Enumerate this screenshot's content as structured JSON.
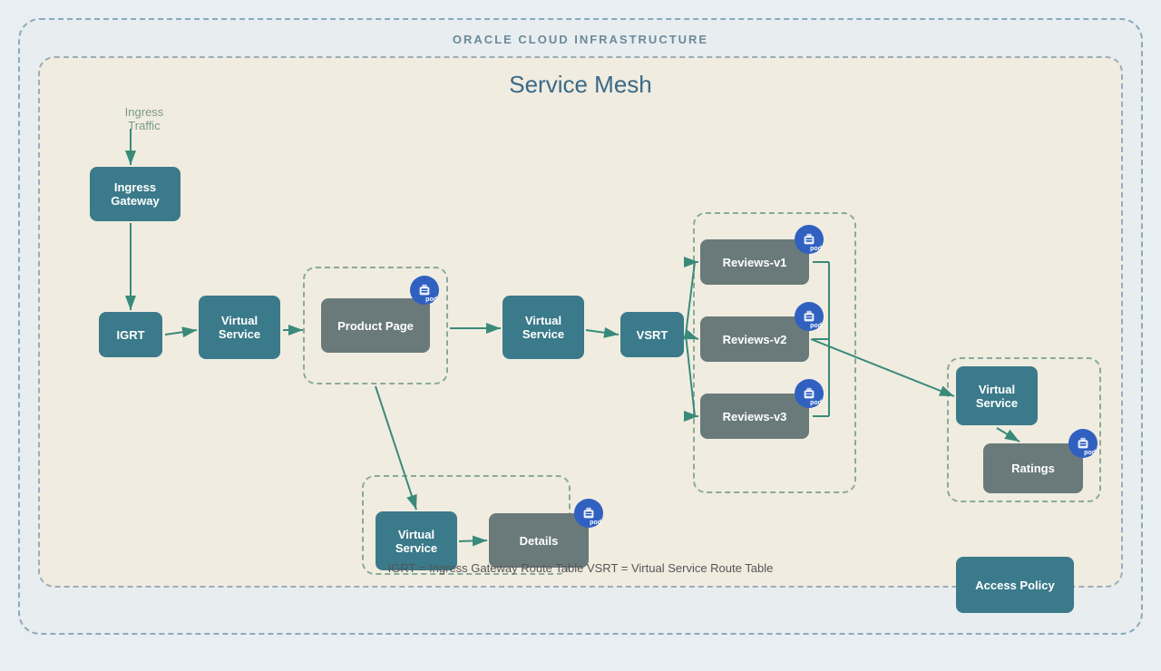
{
  "oci": {
    "label": "ORACLE CLOUD INFRASTRUCTURE"
  },
  "diagram": {
    "title": "Service Mesh",
    "ingress_traffic": "Ingress\nTraffic",
    "nodes": {
      "ingress_gateway": "Ingress\nGateway",
      "igrt": "IGRT",
      "virtual_service_1": "Virtual\nService",
      "product_page": "Product Page",
      "virtual_service_2": "Virtual\nService",
      "vsrt": "VSRT",
      "reviews_v1": "Reviews-v1",
      "reviews_v2": "Reviews-v2",
      "reviews_v3": "Reviews-v3",
      "virtual_service_details": "Virtual\nService",
      "details": "Details",
      "virtual_service_ratings": "Virtual\nService",
      "ratings": "Ratings",
      "access_policy": "Access\nPolicy"
    },
    "legend": "IGRT = Ingress Gateway Route Table    VSRT = Virtual Service Route Table"
  }
}
